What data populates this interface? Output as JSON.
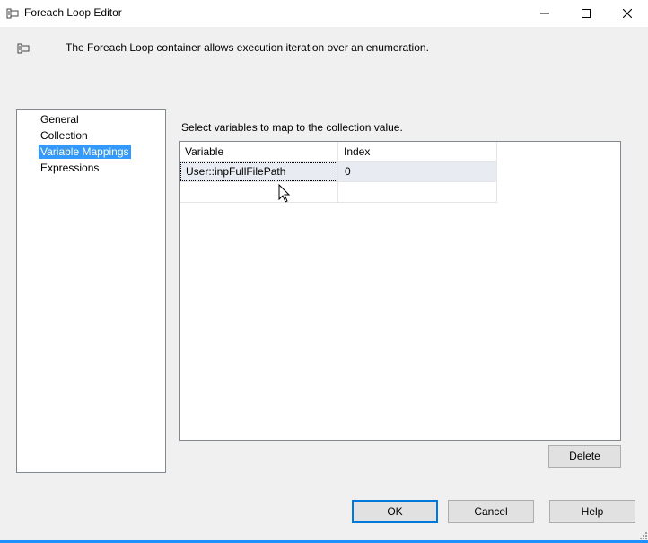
{
  "window": {
    "title": "Foreach Loop Editor",
    "icon": "foreach-container-icon",
    "controls": {
      "minimize": "minimize-icon",
      "maximize": "maximize-icon",
      "close": "close-icon"
    }
  },
  "header": {
    "icon": "foreach-container-icon",
    "description": "The Foreach Loop container allows execution iteration over an enumeration."
  },
  "nav": {
    "items": [
      {
        "label": "General",
        "selected": false
      },
      {
        "label": "Collection",
        "selected": false
      },
      {
        "label": "Variable Mappings",
        "selected": true
      },
      {
        "label": "Expressions",
        "selected": false
      }
    ]
  },
  "mappings": {
    "instruction": "Select variables to map to the collection value.",
    "columns": [
      "Variable",
      "Index"
    ],
    "rows": [
      {
        "variable": "User::inpFullFilePath",
        "index": "0"
      },
      {
        "variable": "",
        "index": ""
      }
    ],
    "delete_label": "Delete"
  },
  "buttons": {
    "ok": "OK",
    "cancel": "Cancel",
    "help": "Help"
  },
  "colors": {
    "selection": "#3399ff",
    "default_button_border": "#0078d7",
    "row_fill": "#e8ecf2"
  }
}
